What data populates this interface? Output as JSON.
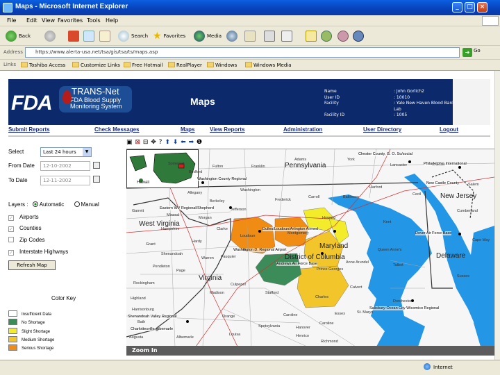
{
  "window": {
    "title": "Maps - Microsoft Internet Explorer",
    "minimize": "_",
    "maximize": "□",
    "close": "×"
  },
  "menu": [
    "File",
    "Edit",
    "View",
    "Favorites",
    "Tools",
    "Help"
  ],
  "toolbar": {
    "back": "Back",
    "search": "Search",
    "favorites": "Favorites",
    "media": "Media"
  },
  "address": {
    "label": "Address",
    "url": "https://www.alerta-usa.net/tsa/gis/tsa/ts/maps.asp",
    "go": "Go"
  },
  "links": {
    "label": "Links",
    "items": [
      "Toshiba Access",
      "Customize Links",
      "Free Hotmail",
      "RealPlayer",
      "Windows",
      "Windows Media"
    ]
  },
  "banner": {
    "fda": "FDA",
    "brand_main": "TRANS-Net",
    "brand_sub": "FDA Blood Supply Monitoring System",
    "page_title": "Maps",
    "user_rows": [
      {
        "k": "Name",
        "v": ": John Gorlich2"
      },
      {
        "k": "User ID",
        "v": ": 10010"
      },
      {
        "k": "Facility",
        "v": ": Yale New Haven Blood Bank"
      },
      {
        "k": "",
        "v": "Lab"
      },
      {
        "k": "Facility ID",
        "v": ": 1005"
      }
    ]
  },
  "nav": [
    "Submit Reports",
    "Check Messages",
    "Maps",
    "View Reports",
    "Administration",
    "User Directory",
    "Logout"
  ],
  "filters": {
    "select_label": "Select",
    "select_value": "Last 24 hours",
    "from_label": "From Date",
    "from_value": "12-10-2002",
    "to_label": "To Date",
    "to_value": "12-11-2002",
    "layers_label": "Layers :",
    "automatic": "Automatic",
    "manual": "Manual",
    "layers": [
      "Airports",
      "Counties",
      "Zip Codes",
      "Interstate Highways"
    ],
    "refresh": "Refresh Map"
  },
  "color_key": {
    "title": "Color Key",
    "items": [
      {
        "label": "Insufficient Data",
        "color": "#ffffff"
      },
      {
        "label": "No Shortage",
        "color": "#3c8c5a"
      },
      {
        "label": "Slight Shortage",
        "color": "#f2ec2a"
      },
      {
        "label": "Medium Shortage",
        "color": "#f2c62a"
      },
      {
        "label": "Serious Shortage",
        "color": "#f08c14"
      }
    ]
  },
  "map": {
    "inset_label": "Hawaii",
    "states": [
      "Pennsylvania",
      "West Virginia",
      "Virginia",
      "Maryland",
      "Delaware",
      "New Jersey",
      "District of Columbia"
    ],
    "counties": [
      "Adams",
      "Franklin",
      "Fulton",
      "Bedford",
      "Somerset",
      "York",
      "Lancaster",
      "Chester",
      "Cecil",
      "Salem",
      "Harford",
      "Baltimore",
      "Carroll",
      "Frederick",
      "Washington",
      "Allegany",
      "Garrett",
      "Grant",
      "Mineral",
      "Hampshire",
      "Morgan",
      "Berkeley",
      "Jefferson",
      "Hardy",
      "Pendleton",
      "Clarke",
      "Loudoun",
      "Fauquier",
      "Warren",
      "Shenandoah",
      "Rockingham",
      "Page",
      "Madison",
      "Culpeper",
      "Stafford",
      "Caroline",
      "Howard",
      "Montgomery",
      "Prince Georges",
      "Anne Arundel",
      "Charles",
      "Calvert",
      "Kent",
      "Queen Anne's",
      "Talbot",
      "Dorchester",
      "Sussex",
      "Cumberland",
      "Cape May",
      "Highland",
      "Bath",
      "Augusta",
      "Albemarle",
      "Henrico",
      "Richmond",
      "Essex",
      "Spotsylvania",
      "Orange",
      "Harrisonburg",
      "Louisa",
      "Hanover",
      "Caroline",
      "St. Marys"
    ],
    "places": [
      "Chester County, G. O. So/social",
      "Philadelphia International",
      "Washington County Regional",
      "New Castle County",
      "Eastern WV Regional/Shepherd",
      "Dulles/Loudoun/Arlington Airmed",
      "Andrews Air Force Base",
      "Dover Air Force Base",
      "Washington D. Regional Airport",
      "Salisbury-Ocean City Wicomico Regional",
      "Shenandoah Valley Regional",
      "Charlottesville-Albemarle"
    ]
  },
  "zoom_label": "Zoom In",
  "status": {
    "zone": "Internet"
  }
}
